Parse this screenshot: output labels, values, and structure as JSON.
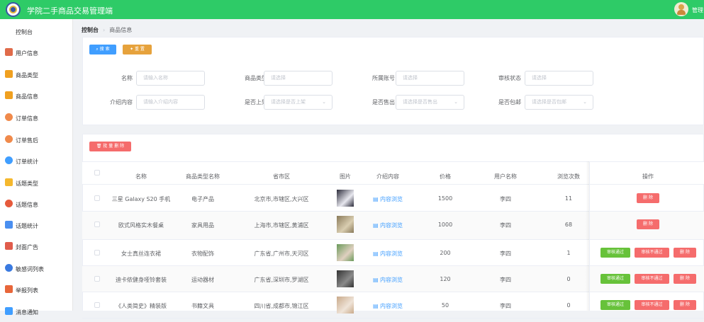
{
  "app": {
    "title": "学院二手商品交易管理端",
    "user": "管理"
  },
  "sidebar": {
    "items": [
      {
        "label": "控制台",
        "icon": "dashboard-icon",
        "color": ""
      },
      {
        "label": "用户信息",
        "icon": "user-icon",
        "color": "#e06b4a"
      },
      {
        "label": "商品类型",
        "icon": "mail-icon",
        "color": "#f0a020"
      },
      {
        "label": "商品信息",
        "icon": "mail-icon",
        "color": "#f0a020"
      },
      {
        "label": "订单信息",
        "icon": "person-icon",
        "color": "#f08a4b"
      },
      {
        "label": "订单售后",
        "icon": "person-icon",
        "color": "#f08a4b"
      },
      {
        "label": "订单统计",
        "icon": "pie-chart-icon",
        "color": "#409eff"
      },
      {
        "label": "话题类型",
        "icon": "puzzle-icon",
        "color": "#f5b82e"
      },
      {
        "label": "话题信息",
        "icon": "circle-icon",
        "color": "#e65a3c"
      },
      {
        "label": "话题统计",
        "icon": "list-icon",
        "color": "#4a8ff0"
      },
      {
        "label": "封面广告",
        "icon": "billboard-icon",
        "color": "#e05c4c"
      },
      {
        "label": "敏感词列表",
        "icon": "disc-icon",
        "color": "#3a7ae0"
      },
      {
        "label": "举报列表",
        "icon": "shield-icon",
        "color": "#e8663a"
      },
      {
        "label": "消息通知",
        "icon": "bell-icon",
        "color": "#409eff"
      }
    ]
  },
  "breadcrumb": {
    "home": "控制台",
    "current": "商品信息"
  },
  "search": {
    "search_button": "搜 索",
    "reset_button": "重 置",
    "fields": [
      {
        "label": "名称",
        "placeholder": "请输入名称"
      },
      {
        "label": "商品类型",
        "placeholder": "请选择"
      },
      {
        "label": "所属账号",
        "placeholder": "请选择"
      },
      {
        "label": "审核状态",
        "placeholder": "请选择"
      },
      {
        "label": "介绍内容",
        "placeholder": "请输入介绍内容"
      },
      {
        "label": "是否上架",
        "placeholder": "请选择是否上架"
      },
      {
        "label": "是否售出",
        "placeholder": "请选择是否售出"
      },
      {
        "label": "是否包邮",
        "placeholder": "请选择是否包邮"
      }
    ]
  },
  "table": {
    "batch_delete": "批 量 删 除",
    "columns": [
      "名称",
      "商品类型名称",
      "省市区",
      "图片",
      "介绍内容",
      "价格",
      "用户名称",
      "浏览次数",
      "操作"
    ],
    "preview_label": "内容浏览",
    "approve_label": "审核通过",
    "reject_label": "审核不通过",
    "delete_label": "删 除",
    "rows": [
      {
        "name": "三星 Galaxy S20 手机",
        "type": "电子产品",
        "region": "北京市,市辖区,大兴区",
        "price": "1500",
        "user": "李四",
        "views": "11",
        "thumb": [
          "#2b2b3a",
          "#e8e8ef"
        ],
        "audit": false
      },
      {
        "name": "欧式风格实木餐桌",
        "type": "家具用品",
        "region": "上海市,市辖区,黄浦区",
        "price": "1000",
        "user": "李四",
        "views": "68",
        "thumb": [
          "#8a7a5a",
          "#d9cdb0"
        ],
        "audit": false
      },
      {
        "name": "女士真丝连衣裙",
        "type": "衣物配饰",
        "region": "广东省,广州市,天河区",
        "price": "200",
        "user": "李四",
        "views": "1",
        "thumb": [
          "#6a9a5a",
          "#e0d0c0"
        ],
        "audit": true
      },
      {
        "name": "迪卡侬健身哑铃套装",
        "type": "运动器材",
        "region": "广东省,深圳市,罗湖区",
        "price": "120",
        "user": "李四",
        "views": "0",
        "thumb": [
          "#333333",
          "#8a8a8a"
        ],
        "audit": true
      },
      {
        "name": "《人类简史》精装版",
        "type": "书籍文具",
        "region": "四川省,成都市,锦江区",
        "price": "50",
        "user": "李四",
        "views": "0",
        "thumb": [
          "#c9a98a",
          "#efe4d8"
        ],
        "audit": true
      }
    ]
  },
  "colors": {
    "header": "#2ecb67",
    "primary": "#409eff",
    "warning": "#e6a23c",
    "danger": "#f56c6c",
    "success": "#67c23a"
  }
}
